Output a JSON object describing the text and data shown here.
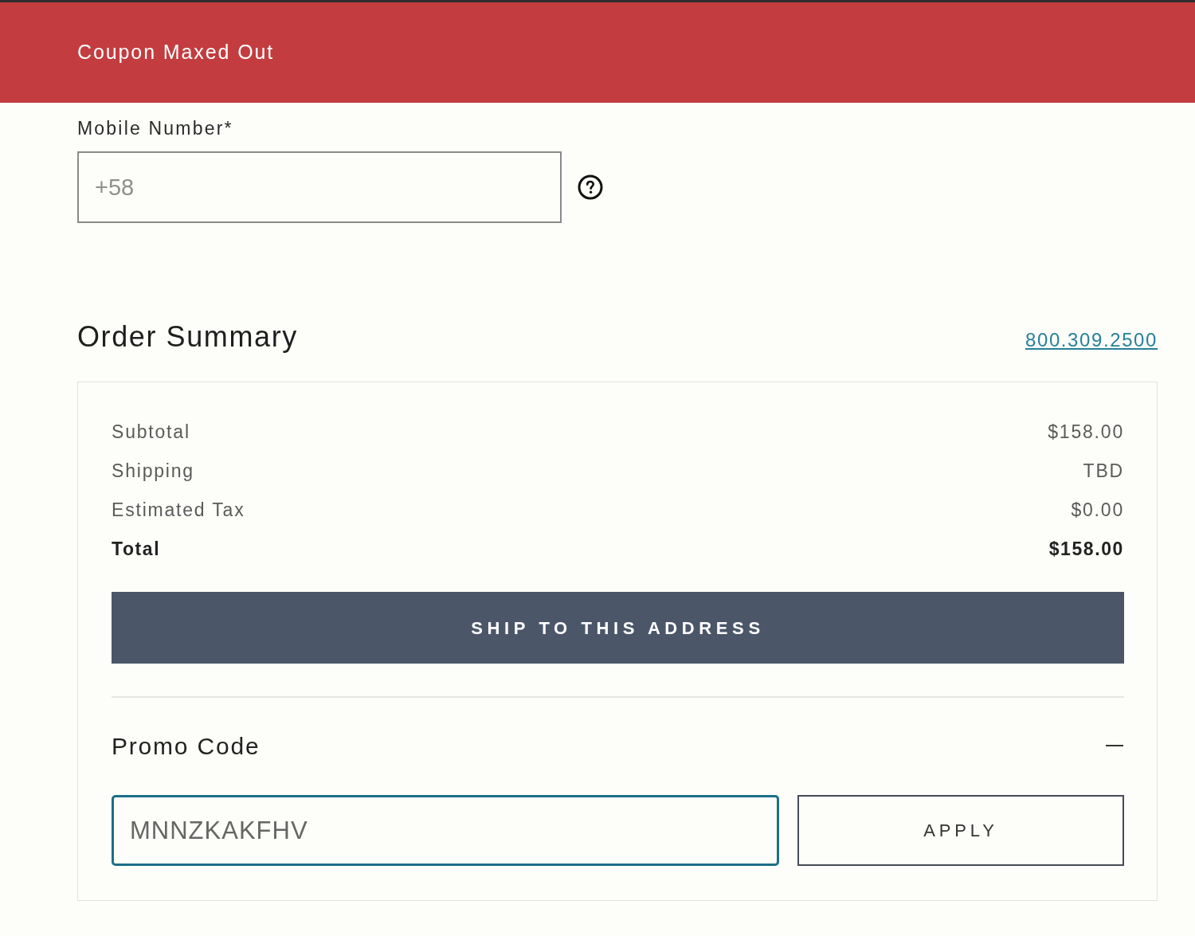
{
  "banner": {
    "text": "Coupon Maxed Out"
  },
  "mobile": {
    "label": "Mobile Number*",
    "placeholder": "+58"
  },
  "summary": {
    "title": "Order Summary",
    "phone": "800.309.2500",
    "rows": [
      {
        "kind": "line",
        "label": "Subtotal",
        "value": "$158.00"
      },
      {
        "kind": "line",
        "label": "Shipping",
        "value": "TBD"
      },
      {
        "kind": "line",
        "label": "Estimated Tax",
        "value": "$0.00"
      },
      {
        "kind": "total",
        "label": "Total",
        "value": "$158.00"
      }
    ],
    "ship_button": "SHIP TO THIS ADDRESS",
    "promo": {
      "title": "Promo Code",
      "expanded": true,
      "value": "MNNZKAKFHV",
      "focused": true,
      "apply_button": "APPLY"
    }
  }
}
